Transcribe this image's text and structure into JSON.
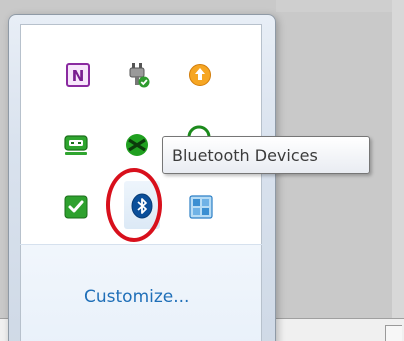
{
  "tray": {
    "tooltip": "Bluetooth Devices",
    "customize_label": "Customize...",
    "icons": [
      {
        "name": "onenote-icon",
        "glyph": "N"
      },
      {
        "name": "power-plug-icon"
      },
      {
        "name": "update-arrow-icon"
      },
      {
        "name": "device-icon"
      },
      {
        "name": "network-x-icon"
      },
      {
        "name": "partial-green-icon"
      },
      {
        "name": "security-check-icon"
      },
      {
        "name": "bluetooth-icon"
      },
      {
        "name": "window-grid-icon"
      }
    ]
  },
  "colors": {
    "link": "#1f6fb8",
    "annotation": "#d8101c",
    "bluetooth_blue": "#0b4f9a"
  }
}
